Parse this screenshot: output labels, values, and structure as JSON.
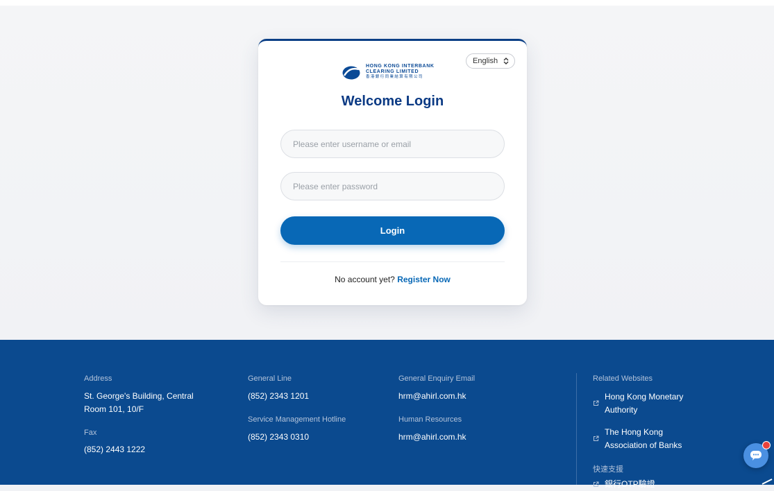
{
  "login": {
    "logo": {
      "line1": "HONG KONG INTERBANK",
      "line2": "CLEARING LIMITED",
      "line3": "香港銀行同業結算有限公司"
    },
    "language": "English",
    "title": "Welcome Login",
    "username_placeholder": "Please enter username or email",
    "password_placeholder": "Please enter password",
    "login_button": "Login",
    "no_account_text": "No account yet?",
    "register_link": "Register Now"
  },
  "footer": {
    "address_label": "Address",
    "address_line1": "St. George's Building, Central",
    "address_line2": "Room 101, 10/F",
    "fax_label": "Fax",
    "fax_value": "(852) 2443 1222",
    "general_line_label": "General Line",
    "general_line_value": "(852) 2343 1201",
    "hotline_label": "Service Management Hotline",
    "hotline_value": "(852) 2343 0310",
    "enquiry_email_label": "General Enquiry Email",
    "enquiry_email_value": "hrm@ahirl.com.hk",
    "hr_label": "Human Resources",
    "hr_value": "hrm@ahirl.com.hk",
    "related_label": "Related Websites",
    "related_links": [
      {
        "line1": "Hong Kong Monetary",
        "line2": "Authority"
      },
      {
        "line1": "The Hong Kong",
        "line2": "Association of Banks"
      }
    ],
    "quick_support_label": "快速支援",
    "quick_support_link": "銀行OTP驗證"
  },
  "colors": {
    "brand_dark": "#0b3a84",
    "primary": "#0868b6",
    "footer_bg": "#0b4a8f"
  },
  "icons": [
    "hkicl-logo-icon",
    "chevron-updown-icon",
    "external-link-icon",
    "chat-icon",
    "notification-badge-icon"
  ]
}
